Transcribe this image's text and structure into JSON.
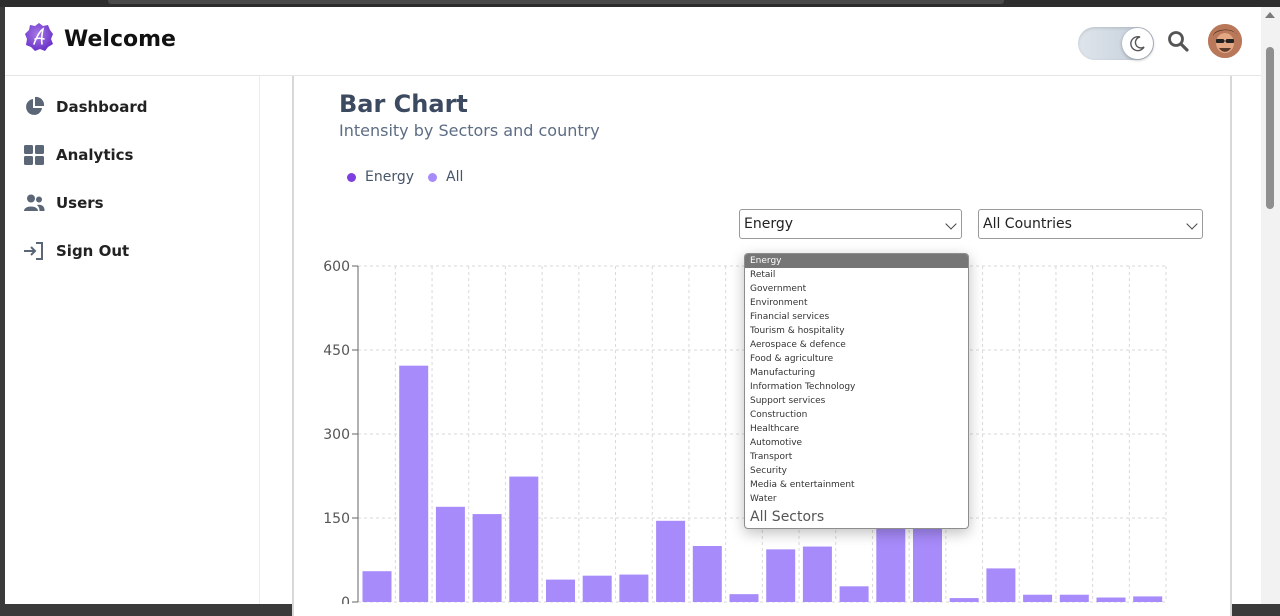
{
  "app": {
    "brand": "Welcome"
  },
  "header": {
    "theme_toggle_icon": "moon-icon",
    "search_icon": "search-icon",
    "avatar": "avatar"
  },
  "sidebar": {
    "items": [
      {
        "label": "Dashboard",
        "icon": "pie-chart-icon"
      },
      {
        "label": "Analytics",
        "icon": "grid-icon"
      },
      {
        "label": "Users",
        "icon": "users-icon"
      },
      {
        "label": "Sign Out",
        "icon": "sign-out-icon"
      }
    ]
  },
  "card": {
    "title": "Bar Chart",
    "subtitle": "Intensity by Sectors and country",
    "legend": [
      {
        "label": "Energy",
        "color": "#7e3fe0"
      },
      {
        "label": "All",
        "color": "#a78bfa"
      }
    ]
  },
  "filters": {
    "sector": {
      "value": "Energy"
    },
    "country": {
      "value": "All Countries"
    }
  },
  "dropdown": {
    "options": [
      "Energy",
      "Retail",
      "Government",
      "Environment",
      "Financial services",
      "Tourism & hospitality",
      "Aerospace & defence",
      "Food & agriculture",
      "Manufacturing",
      "Information Technology",
      "Support services",
      "Construction",
      "Healthcare",
      "Automotive",
      "Transport",
      "Security",
      "Media & entertainment",
      "Water",
      "All Sectors"
    ],
    "selected_index": 0
  },
  "colors": {
    "bar": "#a78bfa",
    "grid": "#d9d9d9",
    "axis": "#666666"
  },
  "chart_data": {
    "type": "bar",
    "title": "Bar Chart",
    "subtitle": "Intensity by Sectors and country",
    "ylim": [
      0,
      600
    ],
    "yticks": [
      "600",
      "450",
      "300",
      "150",
      "0"
    ],
    "grid": true,
    "legend": "top-left",
    "series": [
      {
        "name": "All",
        "values": [
          55,
          422,
          170,
          157,
          224,
          40,
          47,
          49,
          145,
          100,
          14,
          94,
          99,
          28,
          150,
          150,
          7,
          60,
          13,
          13,
          8,
          10
        ]
      }
    ]
  }
}
